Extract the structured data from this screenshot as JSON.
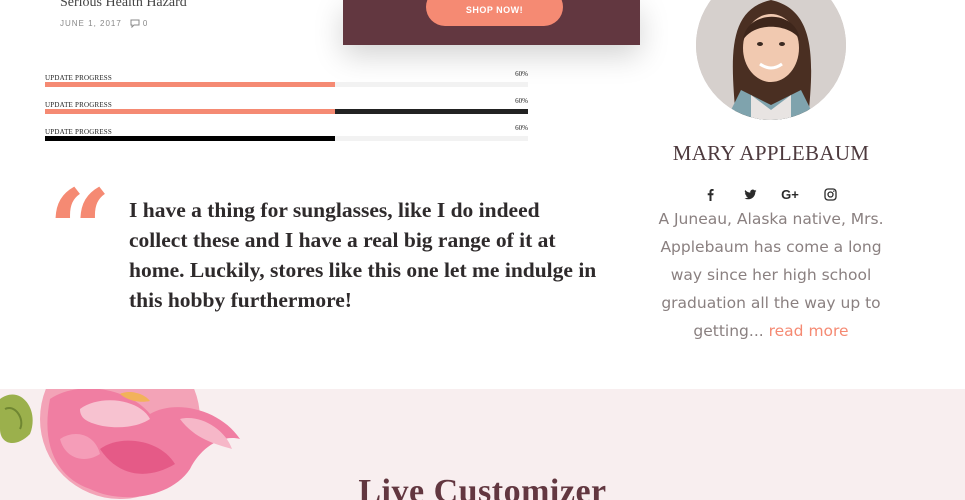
{
  "post": {
    "title": "Serious Health Hazard",
    "date": "JUNE 1, 2017",
    "comments": "0"
  },
  "promo": {
    "button_label": "SHOP NOW!"
  },
  "progress": [
    {
      "label": "UPDATE PROGRESS",
      "percent_text": "60%",
      "value": 0.6,
      "fill_color": "#f58a73",
      "track_color": "#f2f2f2"
    },
    {
      "label": "UPDATE PROGRESS",
      "percent_text": "60%",
      "value": 0.6,
      "fill_color": "#f58a73",
      "track_color": "#222222"
    },
    {
      "label": "UPDATE PROGRESS",
      "percent_text": "60%",
      "value": 0.6,
      "fill_color": "#000000",
      "track_color": "#f2f2f2"
    }
  ],
  "testimonial": {
    "quote": "I have a thing for sunglasses, like I do indeed collect these and I have a real big range of it at home. Luckily, stores like this one let me indulge in this hobby furthermore!"
  },
  "profile": {
    "name": "MARY APPLEBAUM",
    "socials": [
      "facebook-icon",
      "twitter-icon",
      "google-plus-icon",
      "instagram-icon"
    ],
    "google_plus_label": "G+",
    "bio": "A Juneau, Alaska native, Mrs. Applebaum has come a long way since her high school graduation all the way up to getting...",
    "read_more": "read more"
  },
  "section": {
    "title": "Live Customizer"
  },
  "colors": {
    "accent": "#f58a73",
    "brand": "#623740",
    "section_bg": "#f8eeef"
  }
}
